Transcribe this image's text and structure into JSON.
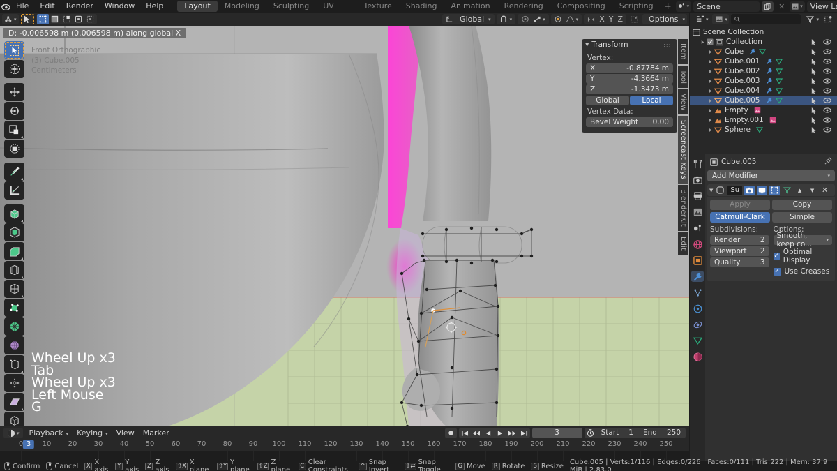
{
  "app": {
    "name": "Blender",
    "version": "2.83.0"
  },
  "topbar": {
    "menus": [
      "File",
      "Edit",
      "Render",
      "Window",
      "Help"
    ],
    "workspaces": [
      {
        "label": "Layout",
        "active": true
      },
      {
        "label": "Modeling",
        "active": false
      },
      {
        "label": "Sculpting",
        "active": false
      },
      {
        "label": "UV Editing",
        "active": false
      },
      {
        "label": "Texture Paint",
        "active": false
      },
      {
        "label": "Shading",
        "active": false
      },
      {
        "label": "Animation",
        "active": false
      },
      {
        "label": "Rendering",
        "active": false
      },
      {
        "label": "Compositing",
        "active": false
      },
      {
        "label": "Scripting",
        "active": false
      }
    ],
    "add_workspace": "+",
    "scene_name": "Scene",
    "view_layer_name": "View Layer"
  },
  "viewport_header": {
    "mode_label": "",
    "orientation_label": "Global",
    "options_label": "Options",
    "axis_x": "X",
    "axis_y": "Y",
    "axis_z": "Z"
  },
  "viewport": {
    "operator_readout": "D: -0.006598 m (0.006598 m) along global X",
    "view_name": "Front Orthographic",
    "object_info": "(3) Cube.005",
    "unit_label": "Centimeters",
    "keycast": [
      "Wheel Up x3",
      "Tab",
      "Wheel Up x3",
      "Left Mouse",
      "G"
    ],
    "vertical_tabs": [
      {
        "label": "Item",
        "active": false
      },
      {
        "label": "Tool",
        "active": false
      },
      {
        "label": "View",
        "active": false
      },
      {
        "label": "Screencast Keys",
        "active": true
      },
      {
        "label": "BlenderKit",
        "active": false
      },
      {
        "label": "Edit",
        "active": false
      }
    ],
    "tools": [
      {
        "name": "tweak-tool",
        "active": true
      },
      {
        "name": "select-box-tool",
        "active": false
      },
      {
        "name": "move-tool",
        "active": false
      },
      {
        "name": "rotate-tool",
        "active": false
      },
      {
        "name": "scale-tool",
        "active": false
      },
      {
        "name": "transform-tool",
        "active": false
      },
      {
        "name": "annotate-tool",
        "active": false
      },
      {
        "name": "measure-tool",
        "active": false
      },
      {
        "name": "extrude-region-tool",
        "active": false
      },
      {
        "name": "inset-faces-tool",
        "active": false
      },
      {
        "name": "bevel-tool",
        "active": false
      },
      {
        "name": "loop-cut-tool",
        "active": false
      },
      {
        "name": "knife-tool",
        "active": false
      },
      {
        "name": "poly-build-tool",
        "active": false
      },
      {
        "name": "spin-tool",
        "active": false
      },
      {
        "name": "smooth-tool",
        "active": false
      },
      {
        "name": "edge-slide-tool",
        "active": false
      },
      {
        "name": "shrink-fatten-tool",
        "active": false
      },
      {
        "name": "shear-tool",
        "active": false
      },
      {
        "name": "rip-region-tool",
        "active": false
      }
    ],
    "colors": {
      "grid_floor": "#c5d3a8",
      "sky": "#b4b4b4",
      "axis_x": "#cf6a6a",
      "accent": "#4772b3"
    }
  },
  "transform_panel": {
    "title": "Transform",
    "vertex_label": "Vertex:",
    "fields": [
      {
        "label": "X",
        "value": "-0.87784 m"
      },
      {
        "label": "Y",
        "value": "-4.3664 m"
      },
      {
        "label": "Z",
        "value": "-1.3473 m"
      }
    ],
    "space_buttons": [
      {
        "label": "Global",
        "active": false
      },
      {
        "label": "Local",
        "active": true
      }
    ],
    "vertex_data_label": "Vertex Data:",
    "bevel_weight": {
      "label": "Bevel Weight",
      "value": "0.00"
    }
  },
  "outliner": {
    "search_placeholder": "",
    "rows": [
      {
        "indent": 0,
        "label": "Scene Collection",
        "icon": "scene-collection-icon",
        "icon_color": "#b8b8b8",
        "selected": false,
        "has_checkbox": false,
        "has_disclosure": false,
        "mods": []
      },
      {
        "indent": 1,
        "label": "Collection",
        "icon": "collection-icon",
        "icon_color": "#b8b8b8",
        "selected": false,
        "has_checkbox": true,
        "has_disclosure": true,
        "mods": []
      },
      {
        "indent": 2,
        "label": "Cube",
        "icon": "mesh-object-icon",
        "icon_color": "#e08a4a",
        "selected": false,
        "has_checkbox": false,
        "has_disclosure": true,
        "mods": [
          "modifier-icon",
          "mesh-data-icon"
        ]
      },
      {
        "indent": 2,
        "label": "Cube.001",
        "icon": "mesh-object-icon",
        "icon_color": "#e08a4a",
        "selected": false,
        "has_checkbox": false,
        "has_disclosure": true,
        "mods": [
          "modifier-icon",
          "mesh-data-icon"
        ]
      },
      {
        "indent": 2,
        "label": "Cube.002",
        "icon": "mesh-object-icon",
        "icon_color": "#e08a4a",
        "selected": false,
        "has_checkbox": false,
        "has_disclosure": true,
        "mods": [
          "modifier-icon",
          "mesh-data-icon"
        ]
      },
      {
        "indent": 2,
        "label": "Cube.003",
        "icon": "mesh-object-icon",
        "icon_color": "#e08a4a",
        "selected": false,
        "has_checkbox": false,
        "has_disclosure": true,
        "mods": [
          "modifier-icon",
          "mesh-data-icon"
        ]
      },
      {
        "indent": 2,
        "label": "Cube.004",
        "icon": "mesh-object-icon",
        "icon_color": "#e08a4a",
        "selected": false,
        "has_checkbox": false,
        "has_disclosure": true,
        "mods": [
          "modifier-icon",
          "mesh-data-icon"
        ]
      },
      {
        "indent": 2,
        "label": "Cube.005",
        "icon": "mesh-object-icon",
        "icon_color": "#f0a868",
        "selected": true,
        "has_checkbox": false,
        "has_disclosure": true,
        "mods": [
          "modifier-icon",
          "mesh-data-icon"
        ]
      },
      {
        "indent": 2,
        "label": "Empty",
        "icon": "empty-image-icon",
        "icon_color": "#e08a4a",
        "selected": false,
        "has_checkbox": false,
        "has_disclosure": true,
        "mods": [
          "image-data-icon"
        ]
      },
      {
        "indent": 2,
        "label": "Empty.001",
        "icon": "empty-image-icon",
        "icon_color": "#e08a4a",
        "selected": false,
        "has_checkbox": false,
        "has_disclosure": true,
        "mods": [
          "image-data-icon"
        ]
      },
      {
        "indent": 2,
        "label": "Sphere",
        "icon": "mesh-object-icon",
        "icon_color": "#e08a4a",
        "selected": false,
        "has_checkbox": false,
        "has_disclosure": true,
        "mods": [
          "mesh-data-icon"
        ]
      }
    ]
  },
  "properties": {
    "tabs": [
      {
        "name": "tool-tab",
        "active": false
      },
      {
        "name": "render-tab",
        "active": false
      },
      {
        "name": "output-tab",
        "active": false
      },
      {
        "name": "view-layer-tab",
        "active": false
      },
      {
        "name": "scene-tab",
        "active": false
      },
      {
        "name": "world-tab",
        "active": false
      },
      {
        "name": "object-tab",
        "active": false
      },
      {
        "name": "modifier-tab",
        "active": true
      },
      {
        "name": "particles-tab",
        "active": false
      },
      {
        "name": "physics-tab",
        "active": false
      },
      {
        "name": "constraints-tab",
        "active": false
      },
      {
        "name": "object-data-tab",
        "active": false
      },
      {
        "name": "material-tab",
        "active": false
      }
    ],
    "breadcrumb": "Cube.005",
    "add_modifier_label": "Add Modifier",
    "modifier": {
      "name": "Su",
      "apply_label": "Apply",
      "copy_label": "Copy",
      "type_buttons": [
        {
          "label": "Catmull-Clark",
          "active": true
        },
        {
          "label": "Simple",
          "active": false
        }
      ],
      "subdivisions_label": "Subdivisions:",
      "options_label": "Options:",
      "subdivisions": [
        {
          "label": "Render",
          "value": "2"
        },
        {
          "label": "Viewport",
          "value": "2"
        },
        {
          "label": "Quality",
          "value": "3"
        }
      ],
      "uv_smooth": "Smooth, keep co...",
      "checkboxes": [
        {
          "label": "Optimal Display",
          "checked": true
        },
        {
          "label": "Use Creases",
          "checked": true
        }
      ]
    }
  },
  "timeline": {
    "menus": [
      "Playback",
      "Keying",
      "View",
      "Marker"
    ],
    "current_frame": "3",
    "start_label": "Start",
    "start_value": "1",
    "end_label": "End",
    "end_value": "250",
    "ticks": [
      "0",
      "10",
      "20",
      "30",
      "40",
      "50",
      "60",
      "70",
      "80",
      "90",
      "100",
      "110",
      "120",
      "130",
      "140",
      "150",
      "160",
      "170",
      "180",
      "190",
      "200",
      "210",
      "220",
      "230",
      "240",
      "250"
    ],
    "playhead_frame": "3"
  },
  "statusbar": {
    "hints": [
      {
        "key": "lmb",
        "label": "Confirm"
      },
      {
        "key": "rmb",
        "label": "Cancel"
      },
      {
        "key": "X",
        "label": "X axis"
      },
      {
        "key": "Y",
        "label": "Y axis"
      },
      {
        "key": "Z",
        "label": "Z axis"
      },
      {
        "key": "⇧X",
        "label": "X plane"
      },
      {
        "key": "⇧Y",
        "label": "Y plane"
      },
      {
        "key": "⇧Z",
        "label": "Z plane"
      },
      {
        "key": "C",
        "label": "Clear Constraints"
      },
      {
        "key": "^",
        "label": "Snap Invert"
      },
      {
        "key": "⇧⇄",
        "label": "Snap Toggle"
      },
      {
        "key": "G",
        "label": "Move"
      },
      {
        "key": "R",
        "label": "Rotate"
      },
      {
        "key": "S",
        "label": "Resize"
      }
    ],
    "stats": "Cube.005 | Verts:1/116 | Edges:0/226 | Faces:0/111 | Tris:222 | Mem: 37.9 MiB | 2.83.0"
  }
}
